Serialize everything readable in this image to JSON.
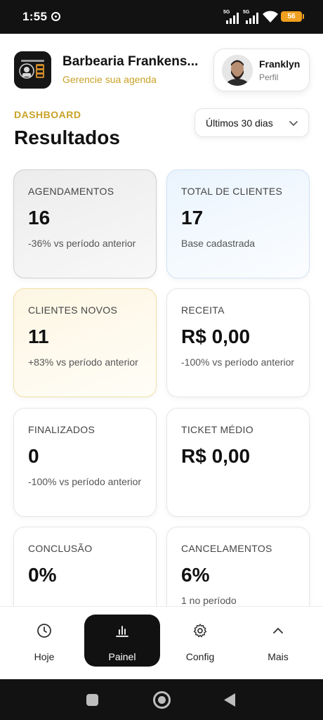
{
  "status_bar": {
    "time": "1:55",
    "network_1": "5G",
    "network_2": "5G",
    "battery": "56"
  },
  "header": {
    "shop_name": "Barbearia Frankens...",
    "shop_subtitle": "Gerencie sua agenda",
    "logo_icon": "barbershop-logo",
    "profile": {
      "name": "Franklyn",
      "subtitle": "Perfil",
      "avatar_icon": "user-avatar"
    }
  },
  "dashboard": {
    "section_label": "DASHBOARD",
    "title": "Resultados",
    "period_select": {
      "selected": "Últimos 30 dias",
      "icon": "chevron-down-icon"
    },
    "cards": [
      {
        "label": "AGENDAMENTOS",
        "value": "16",
        "note": "-36% vs período anterior",
        "accent": "gray"
      },
      {
        "label": "TOTAL DE CLIENTES",
        "value": "17",
        "note": "Base cadastrada",
        "accent": "blue"
      },
      {
        "label": "CLIENTES NOVOS",
        "value": "11",
        "note": "+83% vs período anterior",
        "accent": "yellow"
      },
      {
        "label": "RECEITA",
        "value": "R$ 0,00",
        "note": "-100% vs período anterior",
        "accent": "white"
      },
      {
        "label": "FINALIZADOS",
        "value": "0",
        "note": "-100% vs período anterior",
        "accent": "white"
      },
      {
        "label": "TICKET MÉDIO",
        "value": "R$ 0,00",
        "note": "",
        "accent": "white"
      },
      {
        "label": "CONCLUSÃO",
        "value": "0%",
        "note": "",
        "accent": "white"
      },
      {
        "label": "CANCELAMENTOS",
        "value": "6%",
        "note": "1 no período",
        "accent": "white"
      }
    ]
  },
  "bottom_nav": {
    "items": [
      {
        "label": "Hoje",
        "icon": "clock-icon",
        "active": false
      },
      {
        "label": "Painel",
        "icon": "bar-chart-icon",
        "active": true
      },
      {
        "label": "Config",
        "icon": "gear-icon",
        "active": false
      },
      {
        "label": "Mais",
        "icon": "chevron-up-icon",
        "active": false
      }
    ]
  },
  "colors": {
    "accent_gold": "#c9a227",
    "active_nav": "#111111",
    "battery": "#f0a020"
  }
}
